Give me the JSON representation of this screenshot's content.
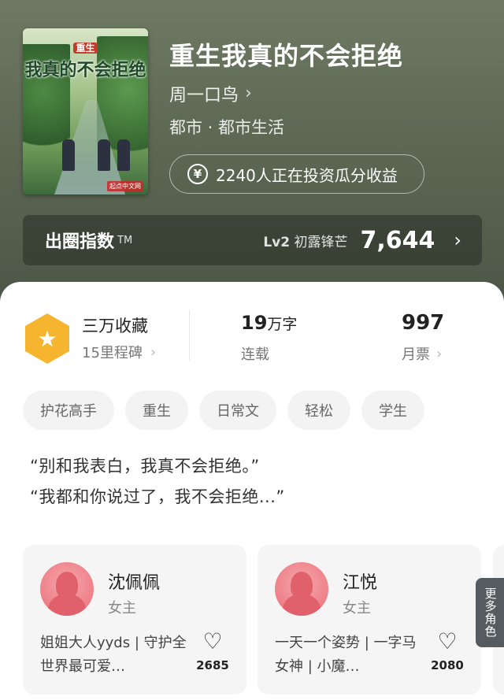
{
  "book": {
    "cover_title_small": "重生",
    "cover_title": "我真的不会拒绝",
    "cover_publisher": "起点中文网",
    "title": "重生我真的不会拒绝",
    "author": "周一口鸟",
    "genre": "都市 · 都市生活",
    "invest_icon": "¥",
    "invest_text": "2240人正在投资瓜分收益"
  },
  "index": {
    "label": "出圈指数",
    "tm": "TM",
    "level_code": "Lv2",
    "level_name": "初露锋芒",
    "value": "7,644"
  },
  "stats": {
    "collect_title": "三万收藏",
    "collect_sub": "15里程碑",
    "words_num": "19",
    "words_unit": "万字",
    "words_status": "连载",
    "tickets_num": "997",
    "tickets_label": "月票"
  },
  "tags": [
    "护花高手",
    "重生",
    "日常文",
    "轻松",
    "学生"
  ],
  "quotes": [
    "“别和我表白，我真不会拒绝。”",
    "“我都和你说过了，我不会拒绝...”"
  ],
  "roles": [
    {
      "name": "沈佩佩",
      "type": "女主",
      "desc": "姐姐大人yyds | 守护全世界最可爱…",
      "likes": "2685"
    },
    {
      "name": "江悦",
      "type": "女主",
      "desc": "一天一个姿势 | 一字马女神 | 小魔…",
      "likes": "2080"
    }
  ],
  "more_roles": "更多角色",
  "colors": {
    "badge": "#f6b52f",
    "hero": "#5e6a55",
    "avatar": "#ee7f88"
  }
}
